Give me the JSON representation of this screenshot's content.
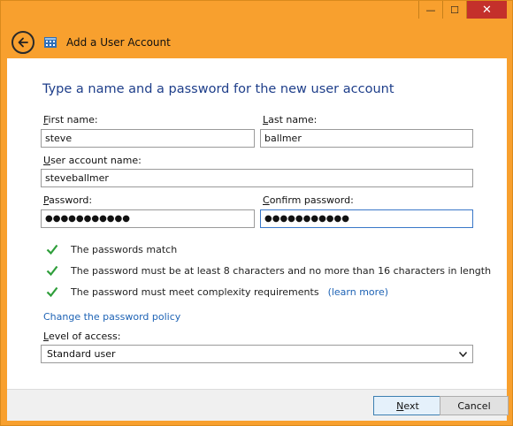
{
  "window": {
    "title": "Add a User Account",
    "minimize_glyph": "—",
    "maximize_glyph": "☐",
    "close_glyph": "✕"
  },
  "page": {
    "heading": "Type a name and a password for the new user account"
  },
  "form": {
    "first_name": {
      "label_access": "F",
      "label_rest": "irst name:",
      "value": "steve"
    },
    "last_name": {
      "label_access": "L",
      "label_rest": "ast name:",
      "value": "ballmer"
    },
    "account_name": {
      "label_access": "U",
      "label_rest": "ser account name:",
      "value": "steveballmer"
    },
    "password": {
      "label_access": "P",
      "label_rest": "assword:",
      "value": "●●●●●●●●●●●"
    },
    "confirm_password": {
      "label_access": "C",
      "label_rest": "onfirm password:",
      "value": "●●●●●●●●●●●"
    }
  },
  "checks": [
    {
      "text": "The passwords match"
    },
    {
      "text": "The password must be at least 8 characters and no more than 16 characters in length"
    },
    {
      "text": "The password must meet complexity requirements",
      "link": "(learn more)"
    }
  ],
  "policy_link": "Change the password policy",
  "access": {
    "label_access": "L",
    "label_rest": "evel of access:",
    "selected": "Standard user"
  },
  "buttons": {
    "next_access": "N",
    "next_rest": "ext",
    "cancel": "Cancel"
  },
  "colors": {
    "frame": "#f8a02e",
    "heading": "#1e3e8a",
    "link": "#1e63b5",
    "check": "#2e9e3a",
    "close": "#c4302b"
  }
}
